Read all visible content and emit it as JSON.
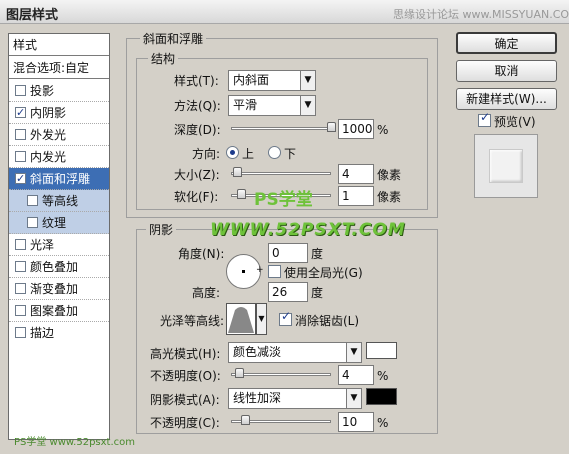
{
  "window": {
    "title": "图层样式",
    "watermark_top": "思缘设计论坛 www.MISSYUAN.COM"
  },
  "left_panel": {
    "header": "样式",
    "blend_options": "混合选项:自定",
    "items": [
      {
        "label": "投影",
        "checked": false
      },
      {
        "label": "内阴影",
        "checked": true
      },
      {
        "label": "外发光",
        "checked": false
      },
      {
        "label": "内发光",
        "checked": false
      },
      {
        "label": "斜面和浮雕",
        "checked": true,
        "selected": true
      },
      {
        "label": "等高线",
        "checked": false,
        "sub": true
      },
      {
        "label": "纹理",
        "checked": false,
        "sub": true
      },
      {
        "label": "光泽",
        "checked": false
      },
      {
        "label": "颜色叠加",
        "checked": false
      },
      {
        "label": "渐变叠加",
        "checked": false
      },
      {
        "label": "图案叠加",
        "checked": false
      },
      {
        "label": "描边",
        "checked": false
      }
    ]
  },
  "bevel": {
    "section_title": "斜面和浮雕",
    "structure_title": "结构",
    "style_label": "样式(T):",
    "style_value": "内斜面",
    "technique_label": "方法(Q):",
    "technique_value": "平滑",
    "depth_label": "深度(D):",
    "depth_value": "1000",
    "depth_unit": "%",
    "depth_fraction": 1.0,
    "direction_label": "方向:",
    "direction_up": "上",
    "direction_down": "下",
    "size_label": "大小(Z):",
    "size_value": "4",
    "size_unit": "像素",
    "size_fraction": 0.02,
    "soften_label": "软化(F):",
    "soften_value": "1",
    "soften_unit": "像素",
    "soften_fraction": 0.06
  },
  "shading": {
    "title": "阴影",
    "angle_label": "角度(N):",
    "angle_value": "0",
    "angle_unit": "度",
    "global_light_label": "使用全局光(G)",
    "altitude_label": "高度:",
    "altitude_value": "26",
    "altitude_unit": "度",
    "gloss_contour_label": "光泽等高线:",
    "anti_alias_label": "消除锯齿(L)",
    "highlight_mode_label": "高光模式(H):",
    "highlight_mode_value": "颜色减淡",
    "highlight_color": "#ffffff",
    "highlight_opacity_label": "不透明度(O):",
    "highlight_opacity_value": "4",
    "highlight_opacity_fraction": 0.04,
    "shadow_mode_label": "阴影模式(A):",
    "shadow_mode_value": "线性加深",
    "shadow_color": "#000000",
    "shadow_opacity_label": "不透明度(C):",
    "shadow_opacity_value": "10",
    "shadow_opacity_fraction": 0.1,
    "percent": "%"
  },
  "buttons": {
    "ok": "确定",
    "cancel": "取消",
    "new_style": "新建样式(W)...",
    "preview": "预览(V)"
  },
  "watermarks": {
    "center_1": "PS学堂",
    "center_2": "WWW.52PSXT.COM",
    "bottom": "PS学堂 www.52psxt.com"
  },
  "colors": {
    "selection": "#3d6eb4",
    "watermark": "#6ec23a"
  }
}
